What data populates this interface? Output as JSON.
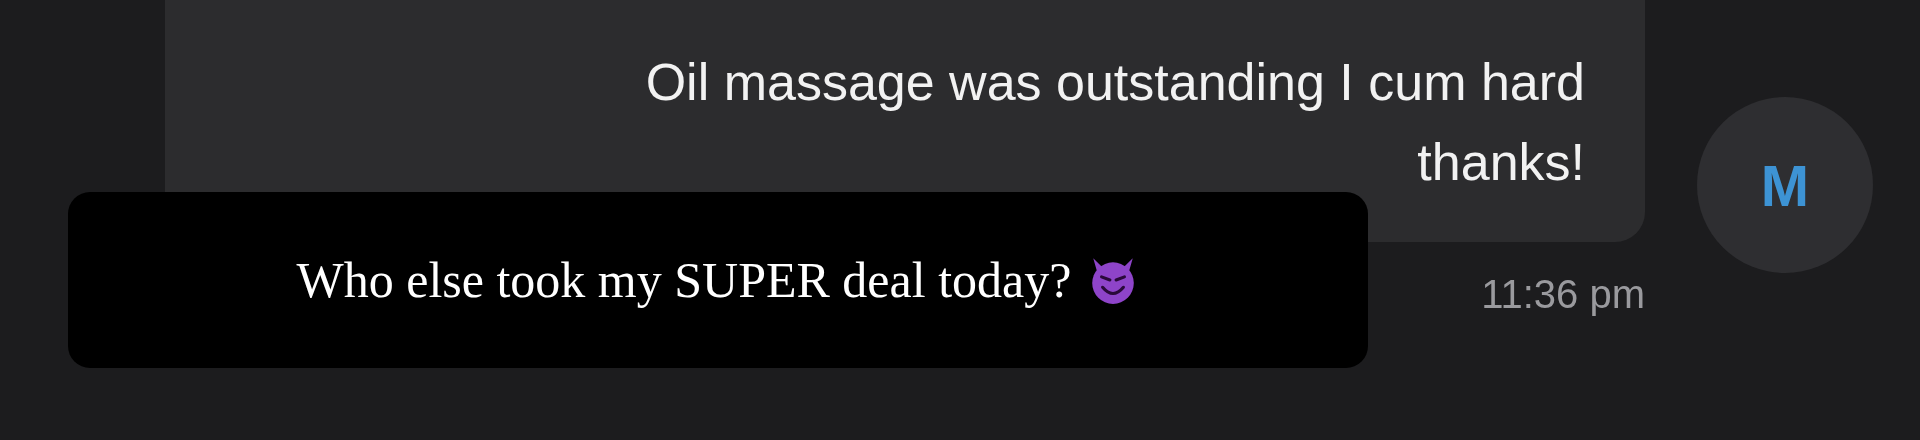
{
  "message": {
    "text": "Oil massage was outstanding I cum hard thanks!",
    "time": "11:36 pm"
  },
  "avatar": {
    "initial": "M"
  },
  "caption": {
    "text": "Who else took my SUPER deal today?"
  }
}
